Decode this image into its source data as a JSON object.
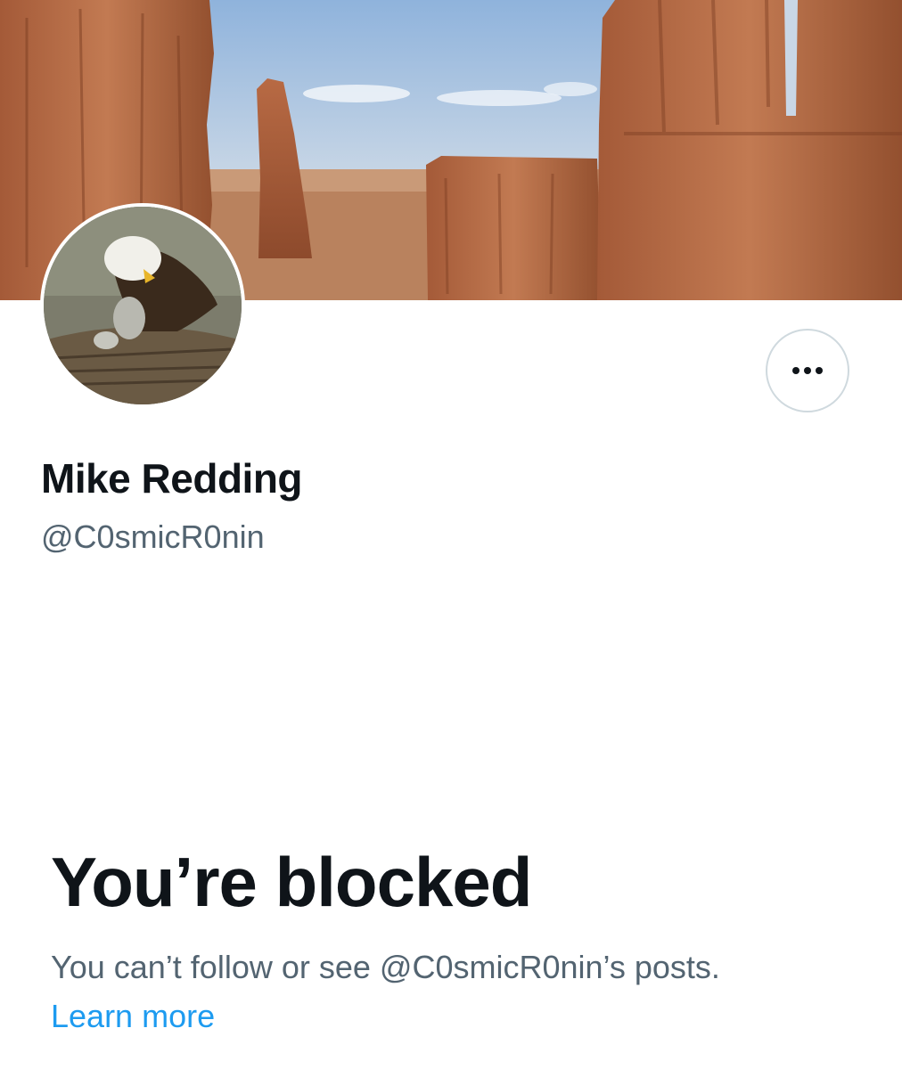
{
  "profile": {
    "display_name": "Mike Redding",
    "handle": "@C0smicR0nin",
    "banner_image": "red-rock-canyon-banner",
    "avatar_image": "bald-eagle-nest-avatar"
  },
  "actions": {
    "more_button_icon": "more-horizontal-icon"
  },
  "blocked": {
    "title": "You’re blocked",
    "description": "You can’t follow or see @C0smicR0nin’s posts.",
    "learn_more": "Learn more"
  },
  "colors": {
    "primary_text": "#0f1419",
    "secondary_text": "#536471",
    "link": "#1d9bf0",
    "border": "#cfd9de"
  }
}
